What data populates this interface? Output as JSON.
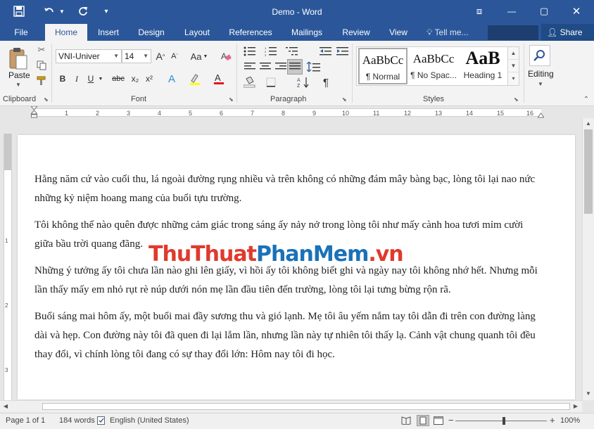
{
  "titlebar": {
    "title": "Demo - Word",
    "save_icon": "floppy-disk-icon",
    "undo_icon": "undo-icon",
    "redo_icon": "redo-icon",
    "customize_icon": "chevron-down-icon",
    "window_glyphs": {
      "ribbon_options": "⧈",
      "minimize": "—",
      "restore": "▢",
      "close": "✕"
    }
  },
  "tabs": [
    {
      "label": "File",
      "active": false
    },
    {
      "label": "Home",
      "active": true
    },
    {
      "label": "Insert",
      "active": false
    },
    {
      "label": "Design",
      "active": false
    },
    {
      "label": "Layout",
      "active": false
    },
    {
      "label": "References",
      "active": false
    },
    {
      "label": "Mailings",
      "active": false
    },
    {
      "label": "Review",
      "active": false
    },
    {
      "label": "View",
      "active": false
    }
  ],
  "tellme": {
    "label": "Tell me..."
  },
  "share": {
    "label": "Share"
  },
  "ribbon": {
    "clipboard": {
      "label": "Clipboard",
      "paste_label": "Paste"
    },
    "font": {
      "label": "Font",
      "font_name": "VNI-Univer",
      "font_size": "14",
      "grow": "A",
      "shrink": "A",
      "case": "Aa",
      "bold": "B",
      "italic": "I",
      "underline": "U",
      "strike": "abc",
      "sub": "x₂",
      "sup": "x²",
      "effects": "A",
      "highlight": "ab",
      "color": "A"
    },
    "paragraph": {
      "label": "Paragraph",
      "pilcrow": "¶"
    },
    "styles": {
      "label": "Styles",
      "items": [
        {
          "sample": "AaBbCc",
          "name": "¶ Normal"
        },
        {
          "sample": "AaBbCc",
          "name": "¶ No Spac..."
        },
        {
          "sample": "AaB",
          "name": "Heading 1"
        }
      ]
    },
    "editing": {
      "label": "Editing"
    }
  },
  "ruler": {
    "h_numbers": [
      "1",
      "2",
      "3",
      "4",
      "5",
      "6",
      "7",
      "8",
      "9",
      "10",
      "11",
      "12",
      "13",
      "14",
      "15",
      "16"
    ],
    "v_numbers": [
      "1",
      "2",
      "3"
    ]
  },
  "document": {
    "paragraphs": [
      "Hằng năm cứ vào cuối thu, lá ngoài đường rụng nhiều và trên không có những đám mây bàng bạc, lòng tôi lại nao nức những kỷ niệm hoang mang của buổi tựu trường.",
      "Tôi không thể nào quên được những cảm giác trong sáng ấy nảy nở trong lòng tôi như mấy cành hoa tươi mỉm cười giữa bầu trời quang đãng.",
      "Những ý tưởng ấy tôi chưa lần nào ghi lên giấy, vì hồi ấy tôi không biết ghi và ngày nay tôi không nhớ hết. Nhưng mỗi lần thấy mấy em nhỏ rụt rè núp dưới nón mẹ lần đầu tiên đến trường, lòng tôi lại tưng bừng rộn rã.",
      "Buổi sáng mai hôm ấy, một buổi mai đầy sương thu và gió lạnh. Mẹ tôi âu yếm nắm tay tôi dẫn đi trên con đường làng dài và hẹp. Con đường này tôi đã quen đi lại lắm lần, nhưng lần này tự nhiên tôi thấy lạ. Cảnh vật chung quanh tôi đều thay đổi, vì chính lòng tôi đang có sự thay đổi lớn: Hôm nay tôi đi học."
    ]
  },
  "watermark": {
    "part1": "ThuThuat",
    "part2": "PhanMem",
    "part3": ".vn"
  },
  "statusbar": {
    "page": "Page 1 of 1",
    "words": "184 words",
    "language": "English (United States)",
    "zoom_minus": "−",
    "zoom_plus": "+",
    "zoom": "100%",
    "zoom_level": 1.0
  },
  "colors": {
    "accent": "#2b579a",
    "watermark_red": "#e03a2e",
    "watermark_blue": "#1a72b8"
  }
}
